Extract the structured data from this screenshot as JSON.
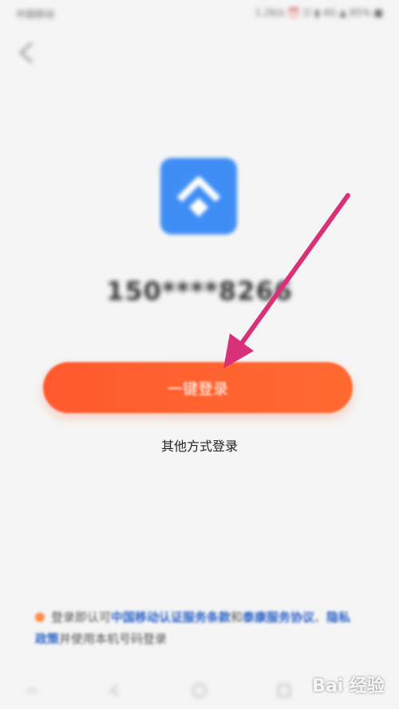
{
  "status_bar": {
    "carrier": "中国移动",
    "indicators": "1.2K/s ⏰ ☷ ▮ 4G ▲ 85% ■"
  },
  "header": {
    "back_icon": "chevron-left-icon"
  },
  "app": {
    "logo_icon": "taikang-logo-icon",
    "logo_color": "#3f8ef5"
  },
  "masked_phone": "150****8266",
  "login_button_label": "一键登录",
  "other_login_label": "其他方式登录",
  "agreement": {
    "prefix": "登录即认可",
    "link1": "中国移动认证服务条款",
    "mid": "和",
    "link2": "泰康服务协议",
    "sep": "、",
    "link3": "隐私政策",
    "suffix": "并使用本机号码登录"
  },
  "colors": {
    "accent": "#ff5a2e",
    "link": "#2c64c8",
    "annotation_arrow": "#d8317a"
  },
  "watermark": "Bai 经验"
}
